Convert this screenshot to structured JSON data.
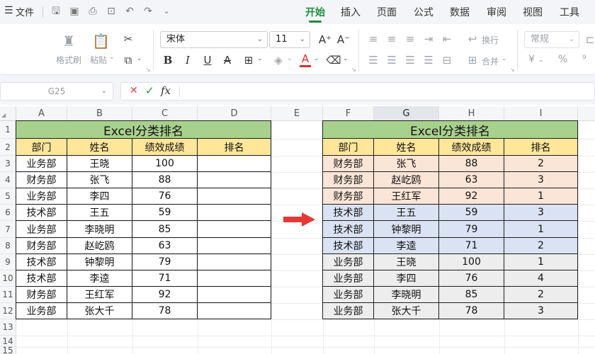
{
  "menubar": {
    "menu_icon": "hamburger-icon",
    "file_label": "文件",
    "tabs": [
      "开始",
      "插入",
      "页面",
      "公式",
      "数据",
      "审阅",
      "视图",
      "工具"
    ],
    "active_tab": "开始"
  },
  "ribbon": {
    "format_painter": "格式刷",
    "paste": "粘贴",
    "font_name": "宋体",
    "font_size": "11",
    "wrap": "换行",
    "merge": "合并",
    "number_format": "常规",
    "currency": "¥",
    "percent": "%"
  },
  "formula_bar": {
    "name_box": "G25",
    "cancel": "✕",
    "confirm": "✓",
    "fx": "fx",
    "content": ""
  },
  "grid": {
    "columns": [
      "A",
      "B",
      "C",
      "D",
      "E",
      "F",
      "G",
      "H",
      "I"
    ],
    "selected_column": "G",
    "rows": [
      "1",
      "2",
      "3",
      "4",
      "5",
      "6",
      "7",
      "8",
      "9",
      "10",
      "11",
      "12",
      "13",
      "14",
      "15"
    ]
  },
  "left_table": {
    "title": "Excel分类排名",
    "headers": [
      "部门",
      "姓名",
      "绩效成绩",
      "排名"
    ],
    "rows": [
      [
        "业务部",
        "王晓",
        "100",
        ""
      ],
      [
        "财务部",
        "张飞",
        "88",
        ""
      ],
      [
        "业务部",
        "李四",
        "76",
        ""
      ],
      [
        "技术部",
        "王五",
        "59",
        ""
      ],
      [
        "业务部",
        "李晓明",
        "85",
        ""
      ],
      [
        "财务部",
        "赵屹鸥",
        "63",
        ""
      ],
      [
        "技术部",
        "钟黎明",
        "79",
        ""
      ],
      [
        "技术部",
        "李逵",
        "71",
        ""
      ],
      [
        "财务部",
        "王红军",
        "92",
        ""
      ],
      [
        "业务部",
        "张大千",
        "78",
        ""
      ]
    ]
  },
  "right_table": {
    "title": "Excel分类排名",
    "headers": [
      "部门",
      "姓名",
      "绩效成绩",
      "排名"
    ],
    "rows": [
      [
        "财务部",
        "张飞",
        "88",
        "2"
      ],
      [
        "财务部",
        "赵屹鸥",
        "63",
        "3"
      ],
      [
        "财务部",
        "王红军",
        "92",
        "1"
      ],
      [
        "技术部",
        "王五",
        "59",
        "3"
      ],
      [
        "技术部",
        "钟黎明",
        "79",
        "1"
      ],
      [
        "技术部",
        "李逵",
        "71",
        "2"
      ],
      [
        "业务部",
        "王晓",
        "100",
        "1"
      ],
      [
        "业务部",
        "李四",
        "76",
        "4"
      ],
      [
        "业务部",
        "李晓明",
        "85",
        "2"
      ],
      [
        "业务部",
        "张大千",
        "78",
        "3"
      ]
    ],
    "row_groups": [
      "finance",
      "finance",
      "finance",
      "tech",
      "tech",
      "tech",
      "sales",
      "sales",
      "sales",
      "sales"
    ]
  },
  "colors": {
    "title_fill": "#a9d18e",
    "header_fill": "#ffe699",
    "finance_fill": "#fbe5d6",
    "tech_fill": "#dae3f3",
    "sales_fill": "#ededed",
    "accent_green": "#1e8e3e",
    "arrow_red": "#e53935"
  }
}
